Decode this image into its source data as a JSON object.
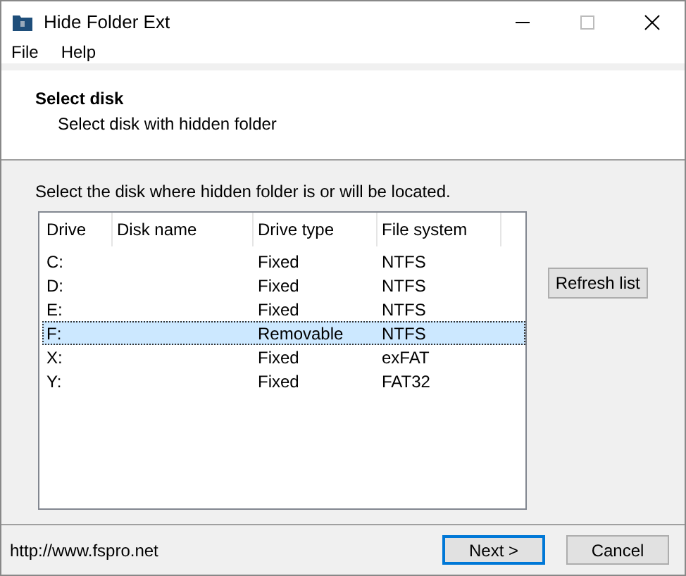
{
  "window": {
    "title": "Hide Folder Ext"
  },
  "menu": [
    "File",
    "Help"
  ],
  "header": {
    "title": "Select disk",
    "subtitle": "Select disk with hidden folder"
  },
  "instruction": "Select the disk where hidden folder is or will be located.",
  "table": {
    "columns": [
      "Drive",
      "Disk name",
      "Drive type",
      "File system"
    ],
    "rows": [
      {
        "cells": [
          "C:",
          "",
          "Fixed",
          "NTFS"
        ],
        "selected": false
      },
      {
        "cells": [
          "D:",
          "",
          "Fixed",
          "NTFS"
        ],
        "selected": false
      },
      {
        "cells": [
          "E:",
          "",
          "Fixed",
          "NTFS"
        ],
        "selected": false
      },
      {
        "cells": [
          "F:",
          "",
          "Removable",
          "NTFS"
        ],
        "selected": true
      },
      {
        "cells": [
          "X:",
          "",
          "Fixed",
          "exFAT"
        ],
        "selected": false
      },
      {
        "cells": [
          "Y:",
          "",
          "Fixed",
          "FAT32"
        ],
        "selected": false
      }
    ]
  },
  "refresh_button": "Refresh list",
  "footer": {
    "link": "http://www.fspro.net",
    "buttons": [
      {
        "label": "Next >",
        "default": true
      },
      {
        "label": "Cancel",
        "default": false
      }
    ]
  }
}
